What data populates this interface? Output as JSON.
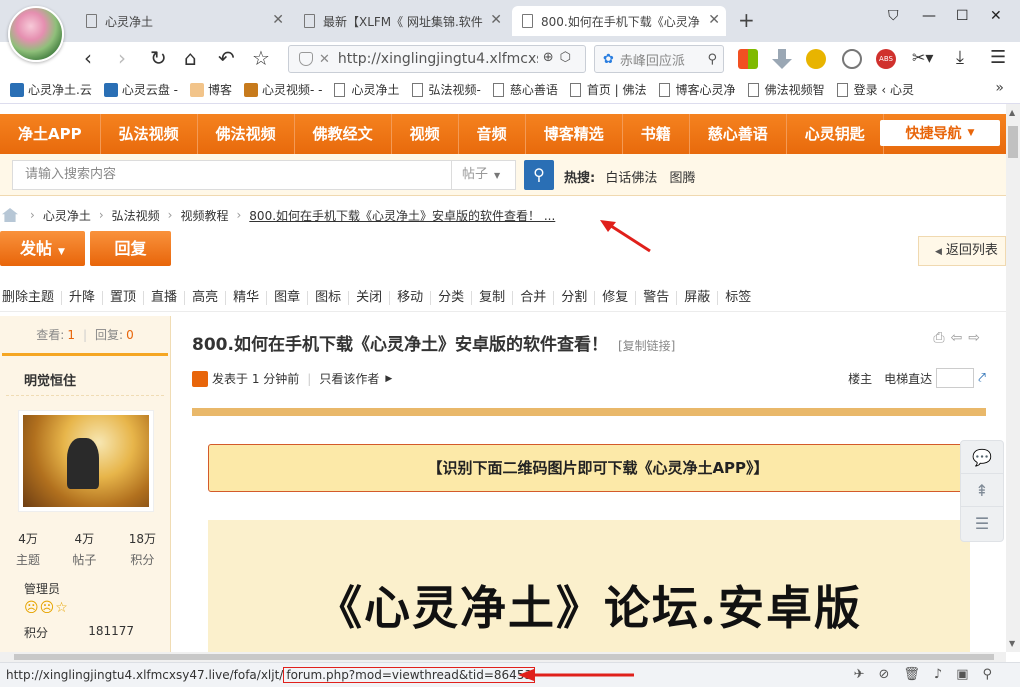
{
  "browser": {
    "tabs": [
      {
        "title": "心灵净土"
      },
      {
        "title": "最新【XLFM《 网址集锦.软件"
      },
      {
        "title": "800.如何在手机下载《心灵净"
      }
    ],
    "new_tab": "+",
    "url": "http://xinglingjingtu4.xlfmcxs",
    "search_placeholder": "赤峰回应派",
    "bookmarks": [
      {
        "label": "心灵净土.云"
      },
      {
        "label": "心灵云盘 -"
      },
      {
        "label": "博客"
      },
      {
        "label": "心灵视频- -"
      },
      {
        "label": "心灵净土"
      },
      {
        "label": "弘法视频-"
      },
      {
        "label": "慈心善语"
      },
      {
        "label": "首页 | 佛法"
      },
      {
        "label": "博客心灵净"
      },
      {
        "label": "佛法视频智"
      },
      {
        "label": "登录 ‹ 心灵"
      }
    ],
    "bookmarks_more": "»",
    "status_url_prefix": "http://xinglingjingtu4.xlfmcxsy47.live/fofa/xljt/",
    "status_url_highlight": "forum.php?mod=viewthread&tid=86453"
  },
  "nav": {
    "items": [
      "净土APP",
      "弘法视频",
      "佛法视频",
      "佛教经文",
      "视频",
      "音频",
      "博客精选",
      "书籍",
      "慈心善语",
      "心灵钥匙"
    ],
    "quick_nav": "快捷导航"
  },
  "search": {
    "placeholder": "请输入搜索内容",
    "type": "帖子",
    "hot_label": "热搜:",
    "hot_items": [
      "白话佛法",
      "图腾"
    ]
  },
  "breadcrumb": [
    "心灵净土",
    "弘法视频",
    "视频教程",
    "800.如何在手机下载《心灵净土》安卓版的软件查看！ ..."
  ],
  "actions": {
    "post": "发帖",
    "reply": "回复",
    "back": "返回列表"
  },
  "mod_tools": [
    "删除主题",
    "升降",
    "置顶",
    "直播",
    "高亮",
    "精华",
    "图章",
    "图标",
    "关闭",
    "移动",
    "分类",
    "复制",
    "合并",
    "分割",
    "修复",
    "警告",
    "屏蔽",
    "标签"
  ],
  "thread": {
    "views_label": "查看:",
    "views": "1",
    "replies_label": "回复:",
    "replies": "0",
    "title": "800.如何在手机下载《心灵净土》安卓版的软件查看！",
    "copy_link": "[复制链接]",
    "posted": "发表于 1 分钟前",
    "author_only": "只看该作者",
    "floor_label": "楼主",
    "elevator_label": "电梯直达",
    "notice": "【识别下面二维码图片即可下载《心灵净土APP》】",
    "banner_text": "《心灵净土》论坛.安卓版"
  },
  "author": {
    "name": "明觉恒住",
    "stats": [
      {
        "value": "4万",
        "label": "主题"
      },
      {
        "value": "4万",
        "label": "帖子"
      },
      {
        "value": "18万",
        "label": "积分"
      }
    ],
    "role": "管理员",
    "score_label": "积分",
    "score": "181177"
  },
  "colors": {
    "accent": "#e8650a",
    "nav": "#f5821f",
    "highlight": "#e0201b"
  }
}
